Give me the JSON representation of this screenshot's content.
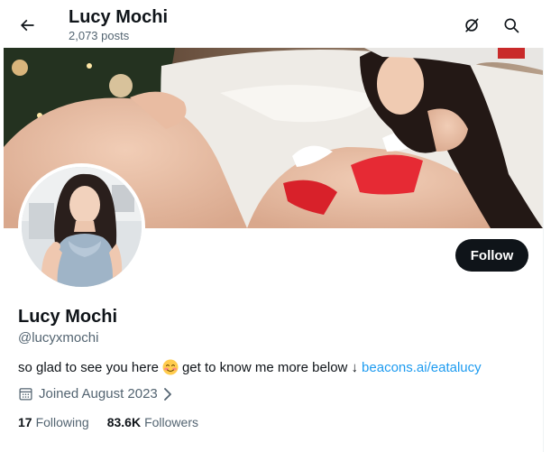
{
  "header": {
    "title": "Lucy Mochi",
    "post_count": "2,073 posts",
    "back_icon": "arrow-left-icon",
    "grok_icon": "grok-icon",
    "search_icon": "search-icon"
  },
  "profile": {
    "display_name": "Lucy Mochi",
    "handle": "@lucyxmochi",
    "bio_text": "so glad to see you here",
    "bio_emoji": "smiling-face-icon",
    "bio_text_2": "get to know me more below ↓",
    "bio_link": "beacons.ai/eatalucy",
    "joined": "Joined August 2023",
    "follow_label": "Follow"
  },
  "stats": {
    "following_count": "17",
    "following_label": "Following",
    "followers_count": "83.6K",
    "followers_label": "Followers"
  },
  "colors": {
    "accent": "#1d9bf0",
    "text_primary": "#0f1419",
    "text_secondary": "#536471",
    "button_dark": "#0f1419"
  }
}
